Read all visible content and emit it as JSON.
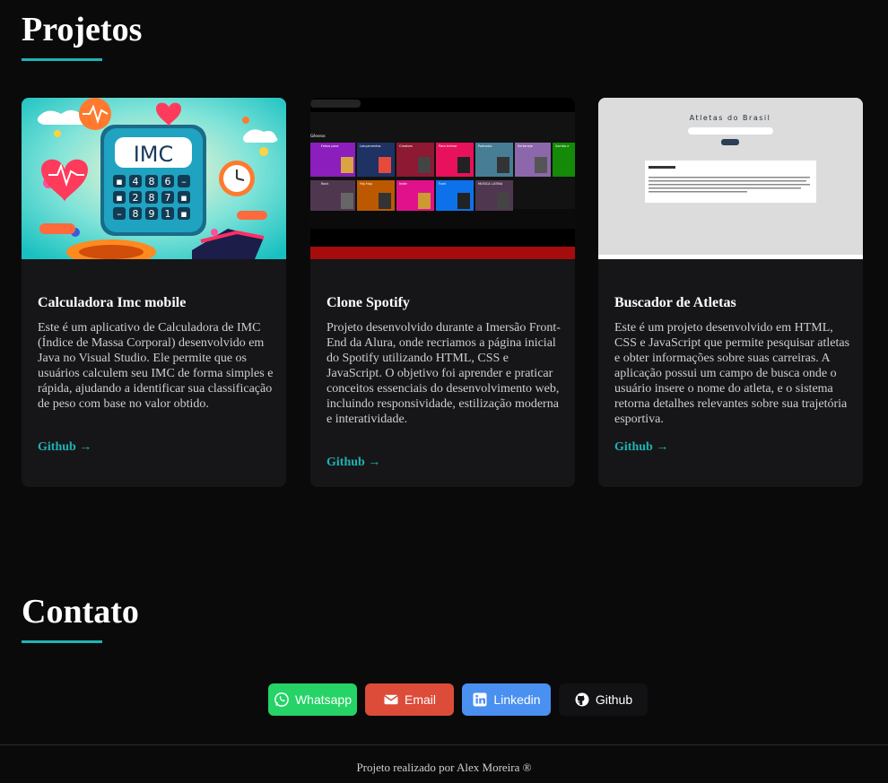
{
  "projects": {
    "title": "Projetos",
    "cards": [
      {
        "title": "Calculadora Imc mobile",
        "description": "Este é um aplicativo de Calculadora de IMC (Índice de Massa Corporal) desenvolvido em Java no Visual Studio. Ele permite que os usuários calculem seu IMC de forma simples e rápida, ajudando a identificar sua classificação de peso com base no valor obtido.",
        "link": "Github →",
        "thumb_text": "IMC"
      },
      {
        "title": "Clone Spotify",
        "description": "Projeto desenvolvido durante a Imersão Front-End da Alura, onde recriamos a página inicial do Spotify utilizando HTML, CSS e JavaScript. O objetivo foi aprender e praticar conceitos essenciais do desenvolvimento web, incluindo responsividade, estilização moderna e interatividade.",
        "link": "Github →",
        "thumb_labels": [
          "Feitos para você",
          "Lançamentos",
          "Creators",
          "Para treinar",
          "Podcasts",
          "Sertanejo",
          "Samba e pagode",
          "Rock",
          "Hip Hop",
          "Indie",
          "Funk",
          "MÚSICA LATINA"
        ]
      },
      {
        "title": "Buscador de Atletas",
        "description": "Este é um projeto desenvolvido em HTML, CSS e JavaScript que permite pesquisar atletas e obter informações sobre suas carreiras. A aplicação possui um campo de busca onde o usuário insere o nome do atleta, e o sistema retorna detalhes relevantes sobre sua trajetória esportiva.",
        "link": "Github →",
        "thumb_title": "Atletas do Brasil"
      }
    ]
  },
  "contact": {
    "title": "Contato",
    "buttons": [
      {
        "label": "Whatsapp",
        "icon": "whatsapp-icon",
        "color": "#25d366"
      },
      {
        "label": "Email",
        "icon": "envelope-icon",
        "color": "#dd4b39"
      },
      {
        "label": "Linkedin",
        "icon": "linkedin-icon",
        "color": "#4a90f0"
      },
      {
        "label": "Github",
        "icon": "github-icon",
        "color": "#121214"
      }
    ]
  },
  "footer": {
    "text": "Projeto realizado por Alex Moreira ®"
  },
  "colors": {
    "background": "#0a0a0b",
    "card": "#161618",
    "accent": "#1fb3b3"
  }
}
